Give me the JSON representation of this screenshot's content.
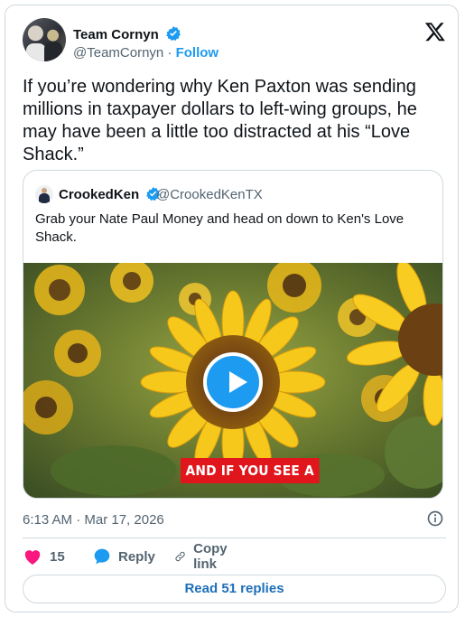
{
  "tweet": {
    "author_name": "Team Cornyn",
    "author_handle": "@TeamCornyn",
    "separator": "·",
    "follow_label": "Follow",
    "text": "If you’re wondering why Ken Paxton was sending millions in taxpayer dollars to left-wing groups, he may have been a little too distracted at his “Love Shack.”",
    "timestamp": "6:13 AM · Mar 17, 2026"
  },
  "quoted": {
    "author_name": "CrookedKen",
    "author_handle": "@CrookedKenTX",
    "text": "Grab your Nate Paul Money and head on down to Ken's Love Shack.",
    "video_caption": "AND IF YOU SEE A"
  },
  "actions": {
    "like_count": "15",
    "reply_label": "Reply",
    "copy_link_label": "Copy link",
    "read_replies_label": "Read 51 replies"
  },
  "icons": {
    "brand": "x-logo-icon",
    "verified": "verified-badge-icon",
    "like": "heart-icon",
    "reply": "reply-bubble-icon",
    "copy": "link-icon",
    "info": "info-icon",
    "play": "play-icon"
  },
  "colors": {
    "accent": "#1d9bf0",
    "like": "#f91880",
    "caption_bg": "#e0161c",
    "muted": "#536471",
    "border": "#cfd9de"
  }
}
